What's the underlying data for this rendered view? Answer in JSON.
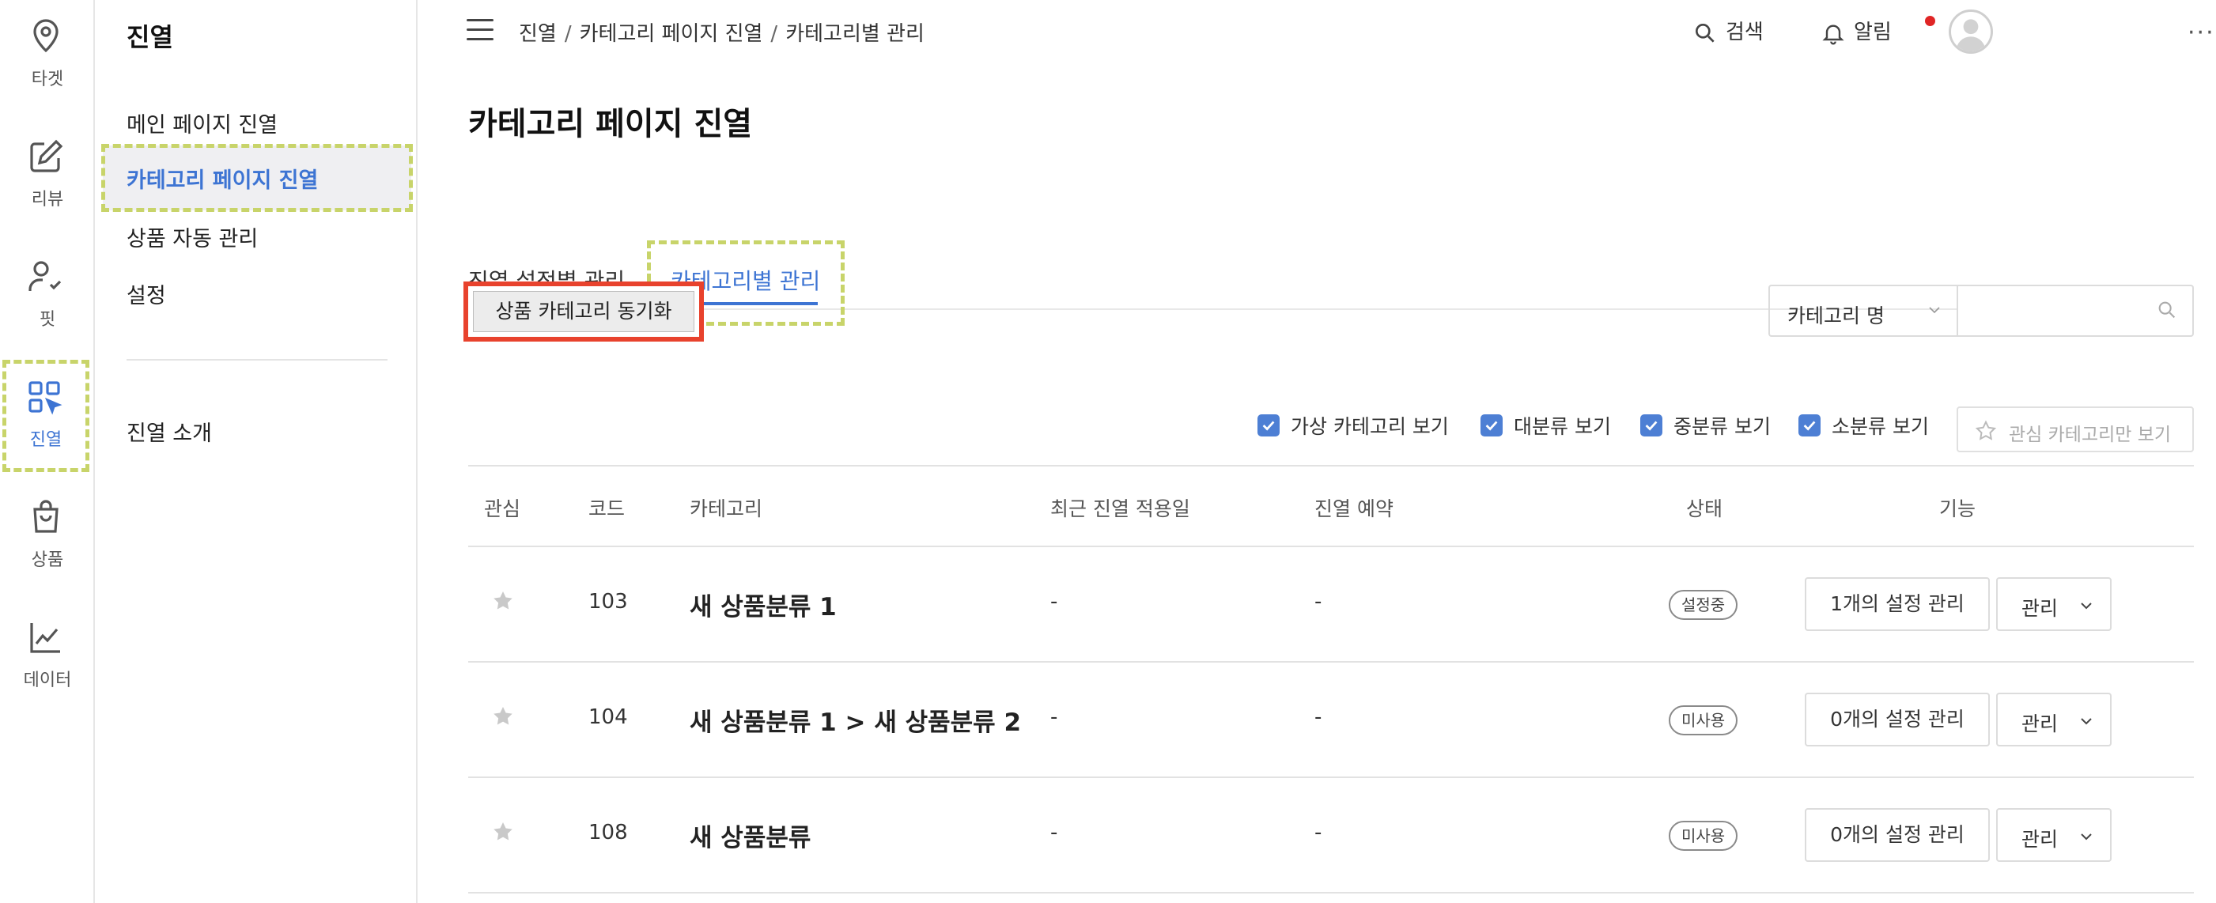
{
  "rail": {
    "items": [
      {
        "label": "타겟",
        "icon": "location-pin-icon"
      },
      {
        "label": "리뷰",
        "icon": "edit-icon"
      },
      {
        "label": "핏",
        "icon": "user-check-icon"
      },
      {
        "label": "진열",
        "icon": "display-grid-icon"
      },
      {
        "label": "상품",
        "icon": "shopping-bag-icon"
      },
      {
        "label": "데이터",
        "icon": "line-chart-icon"
      }
    ]
  },
  "submenu": {
    "title": "진열",
    "items": [
      "메인 페이지 진열",
      "카테고리 페이지 진열",
      "상품 자동 관리",
      "설정"
    ],
    "footer_item": "진열 소개"
  },
  "topbar": {
    "breadcrumb": [
      "진열",
      "카테고리 페이지 진열",
      "카테고리별 관리"
    ],
    "search_label": "검색",
    "alarm_label": "알림",
    "more": "···"
  },
  "main": {
    "title": "카테고리 페이지 진열",
    "tabs": [
      "진열 설정별 관리",
      "카테고리별 관리"
    ],
    "sync_button": "상품 카테고리 동기화",
    "search_select": "카테고리 명",
    "search_value": "",
    "filters": [
      "가상 카테고리 보기",
      "대분류 보기",
      "중분류 보기",
      "소분류 보기"
    ],
    "favorites_only": "관심 카테고리만 보기"
  },
  "table": {
    "columns": [
      "관심",
      "코드",
      "카테고리",
      "최근 진열 적용일",
      "진열 예약",
      "상태",
      "기능"
    ],
    "rows": [
      {
        "code": "103",
        "category": "새 상품분류 1",
        "last_applied": "-",
        "reservation": "-",
        "status": "설정중",
        "manage": "1개의 설정 관리",
        "action": "관리"
      },
      {
        "code": "104",
        "category": "새 상품분류 1 > 새 상품분류 2",
        "last_applied": "-",
        "reservation": "-",
        "status": "미사용",
        "manage": "0개의 설정 관리",
        "action": "관리"
      },
      {
        "code": "108",
        "category": "새 상품분류",
        "last_applied": "-",
        "reservation": "-",
        "status": "미사용",
        "manage": "0개의 설정 관리",
        "action": "관리"
      }
    ]
  },
  "colors": {
    "accent": "#3d74d3",
    "highlight_dashed": "#c8d46a",
    "annotation_red": "#e8422d",
    "alert_dot": "#e02525"
  }
}
